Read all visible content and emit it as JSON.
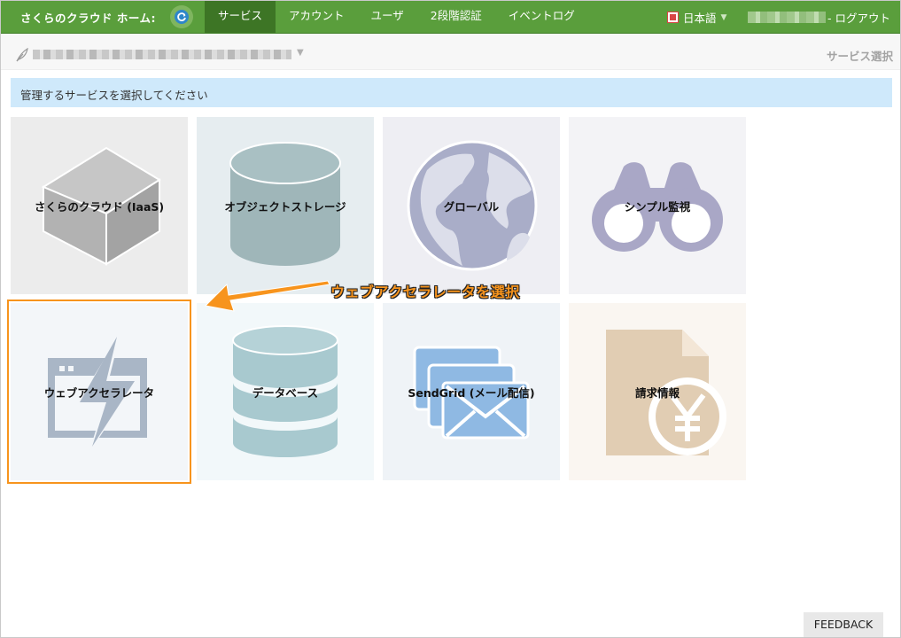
{
  "header": {
    "brand": "さくらのクラウド ホーム:",
    "nav": [
      {
        "label": "サービス",
        "active": true
      },
      {
        "label": "アカウント",
        "active": false
      },
      {
        "label": "ユーザ",
        "active": false
      },
      {
        "label": "2段階認証",
        "active": false
      },
      {
        "label": "イベントログ",
        "active": false
      }
    ],
    "language": "日本語",
    "logout": "- ログアウト"
  },
  "subheader": {
    "service_select": "サービス選択"
  },
  "notice": "管理するサービスを選択してください",
  "tiles": [
    {
      "label": "さくらのクラウド (IaaS)",
      "icon": "cube-icon",
      "bg": "#ececec"
    },
    {
      "label": "オブジェクトストレージ",
      "icon": "cylinder-icon",
      "bg": "#e6edf0"
    },
    {
      "label": "グローバル",
      "icon": "globe-icon",
      "bg": "#eeeef3"
    },
    {
      "label": "シンプル監視",
      "icon": "binoculars-icon",
      "bg": "#f3f3f6"
    },
    {
      "label": "ウェブアクセラレータ",
      "icon": "lightning-icon",
      "bg": "#f3f6f9"
    },
    {
      "label": "データベース",
      "icon": "database-icon",
      "bg": "#f2f8fa"
    },
    {
      "label": "SendGrid (メール配信)",
      "icon": "mail-icon",
      "bg": "#eff3f7"
    },
    {
      "label": "請求情報",
      "icon": "invoice-yen-icon",
      "bg": "#faf6f1"
    }
  ],
  "annotation": {
    "callout": "ウェブアクセラレータを選択",
    "accent_color": "#f7941d"
  },
  "feedback": "FEEDBACK",
  "colors": {
    "header_green": "#5a9e3c",
    "active_nav": "#3d7525",
    "notice_bg": "#cfe9fb"
  }
}
